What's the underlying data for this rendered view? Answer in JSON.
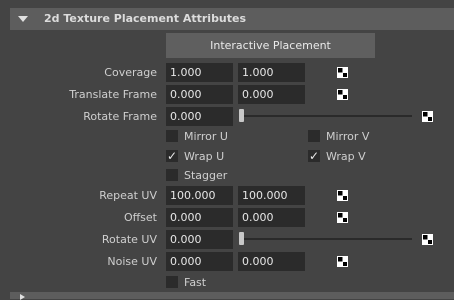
{
  "section": {
    "title": "2d Texture Placement Attributes"
  },
  "interactive_button": "Interactive Placement",
  "coverage": {
    "label": "Coverage",
    "u": "1.000",
    "v": "1.000"
  },
  "translate_frame": {
    "label": "Translate Frame",
    "u": "0.000",
    "v": "0.000"
  },
  "rotate_frame": {
    "label": "Rotate Frame",
    "value": "0.000"
  },
  "mirror_u": {
    "label": "Mirror U",
    "checked": false
  },
  "mirror_v": {
    "label": "Mirror V",
    "checked": false
  },
  "wrap_u": {
    "label": "Wrap U",
    "checked": true
  },
  "wrap_v": {
    "label": "Wrap V",
    "checked": true
  },
  "stagger": {
    "label": "Stagger",
    "checked": false
  },
  "repeat_uv": {
    "label": "Repeat UV",
    "u": "100.000",
    "v": "100.000"
  },
  "offset": {
    "label": "Offset",
    "u": "0.000",
    "v": "0.000"
  },
  "rotate_uv": {
    "label": "Rotate UV",
    "value": "0.000"
  },
  "noise_uv": {
    "label": "Noise UV",
    "u": "0.000",
    "v": "0.000"
  },
  "fast": {
    "label": "Fast",
    "checked": false
  },
  "checkmark": "✓"
}
